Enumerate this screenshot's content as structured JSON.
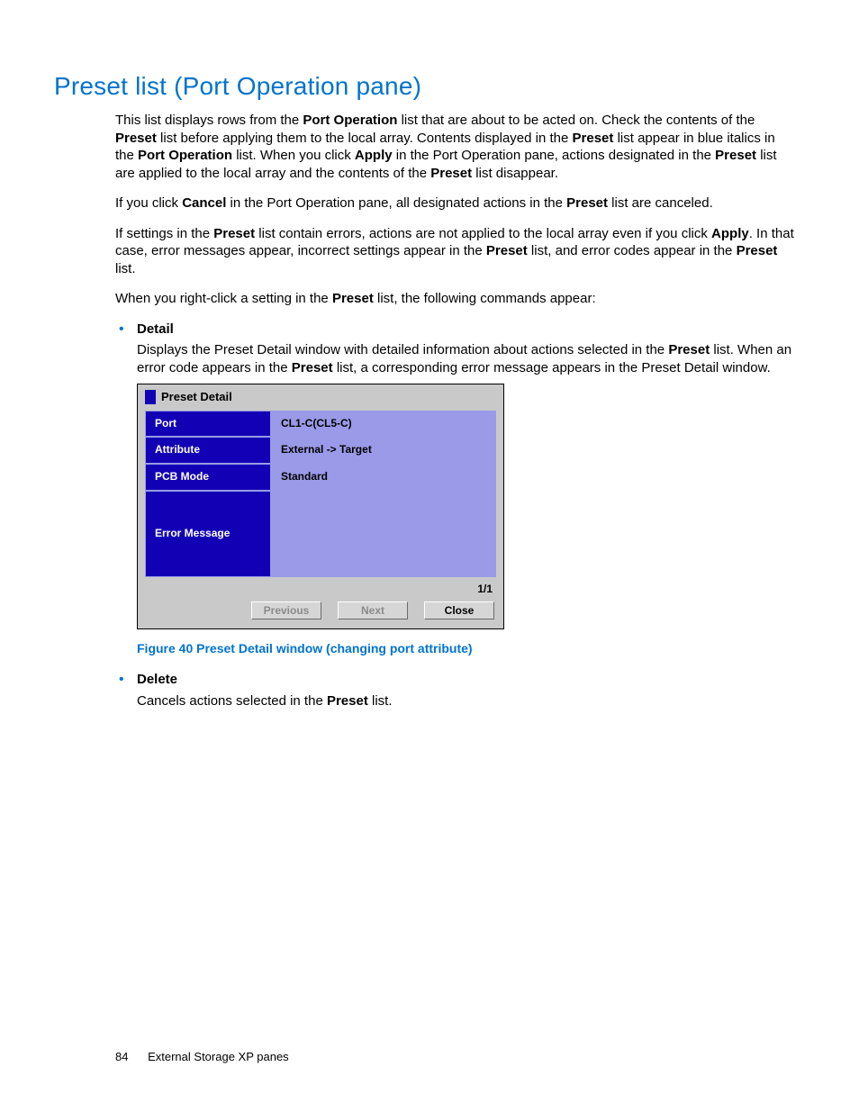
{
  "heading": "Preset list (Port Operation pane)",
  "para1_a": "This list displays rows from the ",
  "para1_b": "Port Operation",
  "para1_c": " list that are about to be acted on. Check the contents of the ",
  "para1_d": "Preset",
  "para1_e": " list before applying them to the local array. Contents displayed in the ",
  "para1_f": "Preset",
  "para1_g": " list appear in blue italics in the ",
  "para1_h": "Port Operation",
  "para1_i": " list. When you click ",
  "para1_j": "Apply",
  "para1_k": " in the Port Operation pane, actions designated in the ",
  "para1_l": "Preset",
  "para1_m": " list are applied to the local array and the contents of the ",
  "para1_n": "Preset",
  "para1_o": " list disappear.",
  "para2_a": "If you click ",
  "para2_b": "Cancel",
  "para2_c": " in the Port Operation pane, all designated actions in the ",
  "para2_d": "Preset",
  "para2_e": " list are canceled.",
  "para3_a": "If settings in the ",
  "para3_b": "Preset",
  "para3_c": " list contain errors, actions are not applied to the local array even if you click ",
  "para3_d": "Apply",
  "para3_e": ". In that case, error messages appear, incorrect settings appear in the ",
  "para3_f": "Preset",
  "para3_g": " list, and error codes appear in the ",
  "para3_h": "Preset",
  "para3_i": " list.",
  "para4_a": "When you right-click a setting in the ",
  "para4_b": "Preset",
  "para4_c": " list, the following commands appear:",
  "detail": {
    "name": "Detail",
    "desc_a": "Displays the Preset Detail window with detailed information about actions selected in the ",
    "desc_b": "Preset",
    "desc_c": " list. When an error code appears in the ",
    "desc_d": "Preset",
    "desc_e": " list, a corresponding error message appears in the Preset Detail window."
  },
  "window": {
    "title": "Preset Detail",
    "rows": {
      "port_label": "Port",
      "port_value": "CL1-C(CL5-C)",
      "attr_label": "Attribute",
      "attr_value": "External -> Target",
      "pcb_label": "PCB Mode",
      "pcb_value": "Standard",
      "err_label": "Error Message",
      "err_value": ""
    },
    "counter": "1/1",
    "buttons": {
      "prev": "Previous",
      "next": "Next",
      "close": "Close"
    }
  },
  "figure_caption": "Figure 40 Preset Detail window (changing port attribute)",
  "delete": {
    "name": "Delete",
    "desc_a": "Cancels actions selected in the ",
    "desc_b": "Preset",
    "desc_c": " list."
  },
  "footer": {
    "page": "84",
    "section": "External Storage XP panes"
  }
}
